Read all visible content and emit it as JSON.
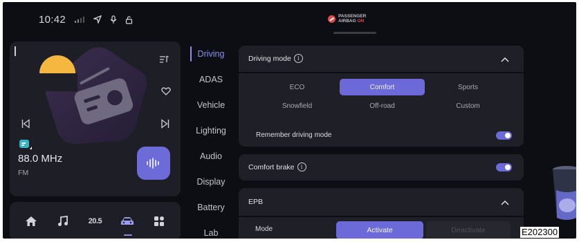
{
  "status_bar": {
    "time": "10:42",
    "icons": [
      "signal-icon",
      "location-arrow-icon",
      "microphone-icon",
      "lock-icon"
    ]
  },
  "airbag": {
    "line1": "PASSENGER",
    "line2_prefix": "AIRBAG ",
    "line2_state": "ON"
  },
  "media": {
    "frequency": "88.0 MHz",
    "band": "FM",
    "icons": [
      "playlist-icon",
      "heart-icon",
      "previous-icon",
      "next-icon",
      "radio-source-icon",
      "waveform-icon"
    ]
  },
  "dock": {
    "temperature": "20.5",
    "icons": [
      "home-icon",
      "music-icon",
      "climate-icon",
      "car-icon",
      "apps-icon"
    ],
    "active": "car-icon"
  },
  "nav": {
    "items": [
      "Driving",
      "ADAS",
      "Vehicle",
      "Lighting",
      "Audio",
      "Display",
      "Battery",
      "Lab"
    ],
    "active": "Driving"
  },
  "driving_mode": {
    "title": "Driving mode",
    "options": [
      "ECO",
      "Comfort",
      "Sports",
      "Snowfield",
      "Off-road",
      "Custom"
    ],
    "selected": "Comfort",
    "remember_label": "Remember driving mode",
    "remember_on": true
  },
  "comfort_brake": {
    "label": "Comfort brake",
    "on": true
  },
  "epb": {
    "title": "EPB",
    "mode_label": "Mode",
    "options": [
      "Activate",
      "Deactivate"
    ],
    "selected": "Activate"
  },
  "colors": {
    "accent": "#6b6ad8",
    "background": "#0d0e13",
    "card": "#1f2027"
  },
  "figure_code": "E202300"
}
